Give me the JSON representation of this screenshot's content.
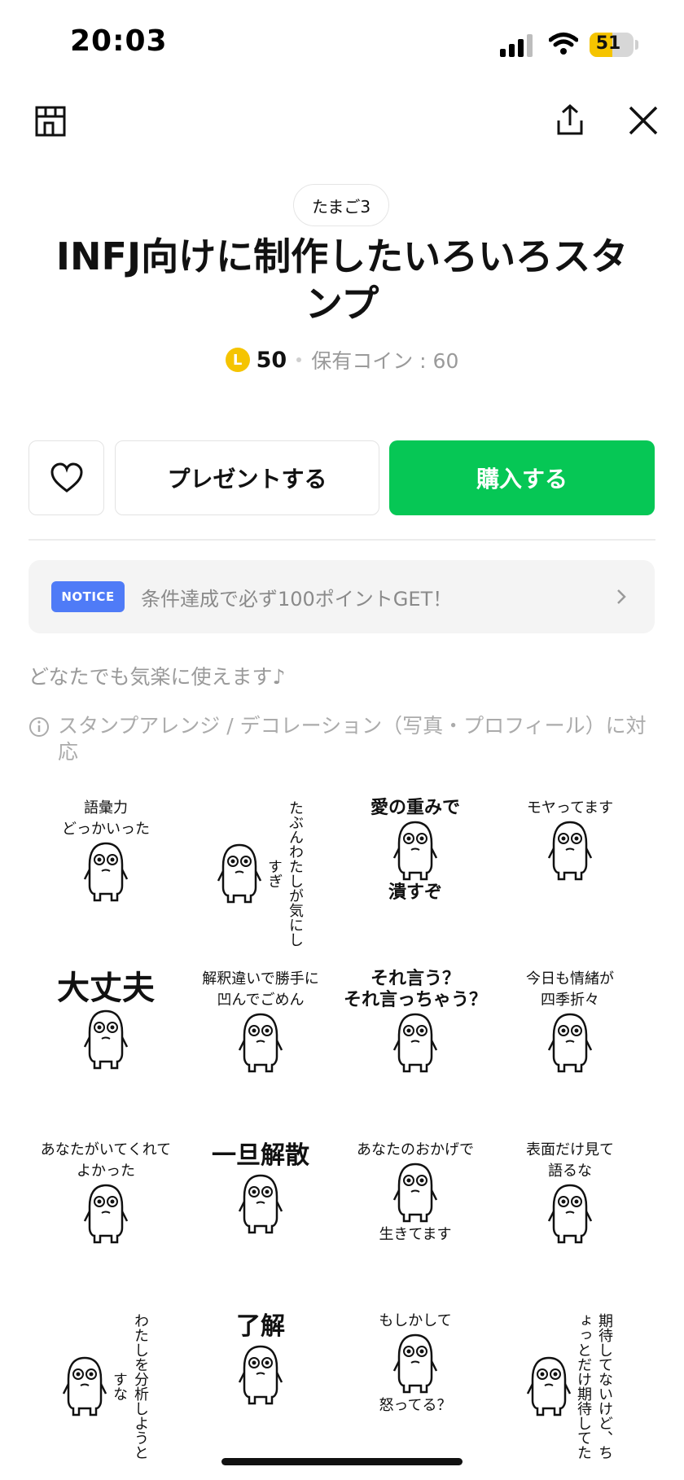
{
  "status_bar": {
    "time": "20:03",
    "battery_level": "51",
    "battery_fraction": 0.51
  },
  "header": {
    "tag": "たまご3",
    "title": "INFJ向けに制作したいろいろスタンプ"
  },
  "price": {
    "coin_symbol": "L",
    "amount": "50",
    "owned": "保有コイン : 60"
  },
  "actions": {
    "present_label": "プレゼントする",
    "buy_label": "購入する",
    "buy_color": "#06c755"
  },
  "notice": {
    "badge": "NOTICE",
    "text": "条件達成で必ず100ポイントGET！"
  },
  "description": "どなたでも気楽に使えます♪",
  "arrange_note": "スタンプアレンジ / デコレーション（写真・プロフィール）に対応",
  "stickers": [
    {
      "text": "語彙力\nどっかいった",
      "style": "normal"
    },
    {
      "text": "たぶんわたしが気にしすぎ",
      "style": "vert"
    },
    {
      "text": "愛の重みで",
      "text2": "潰すぞ",
      "style": "bold"
    },
    {
      "text": "モヤってます",
      "style": "normal"
    },
    {
      "text": "大丈夫",
      "style": "big"
    },
    {
      "text": "解釈違いで勝手に\n凹んでごめん",
      "style": "normal"
    },
    {
      "text": "それ言う？\nそれ言っちゃう？",
      "style": "bold"
    },
    {
      "text": "今日も情緒が\n四季折々",
      "style": "normal"
    },
    {
      "text": "あなたがいてくれて\nよかった",
      "style": "normal"
    },
    {
      "text": "一旦解散",
      "style": "mid"
    },
    {
      "text": "あなたのおかげで",
      "text2": "生きてます",
      "style": "normal"
    },
    {
      "text": "表面だけ見て\n語るな",
      "style": "normal"
    },
    {
      "text": "わたしを分析しようとすな",
      "style": "vert"
    },
    {
      "text": "了解",
      "style": "mid"
    },
    {
      "text": "もしかして",
      "text2": "怒ってる？",
      "style": "normal"
    },
    {
      "text": "期待してないけど、ちょっとだけ期待してた",
      "style": "vert"
    }
  ],
  "icons": [
    "store-icon",
    "share-icon",
    "close-icon",
    "heart-icon",
    "chevron-right-icon",
    "info-icon"
  ]
}
